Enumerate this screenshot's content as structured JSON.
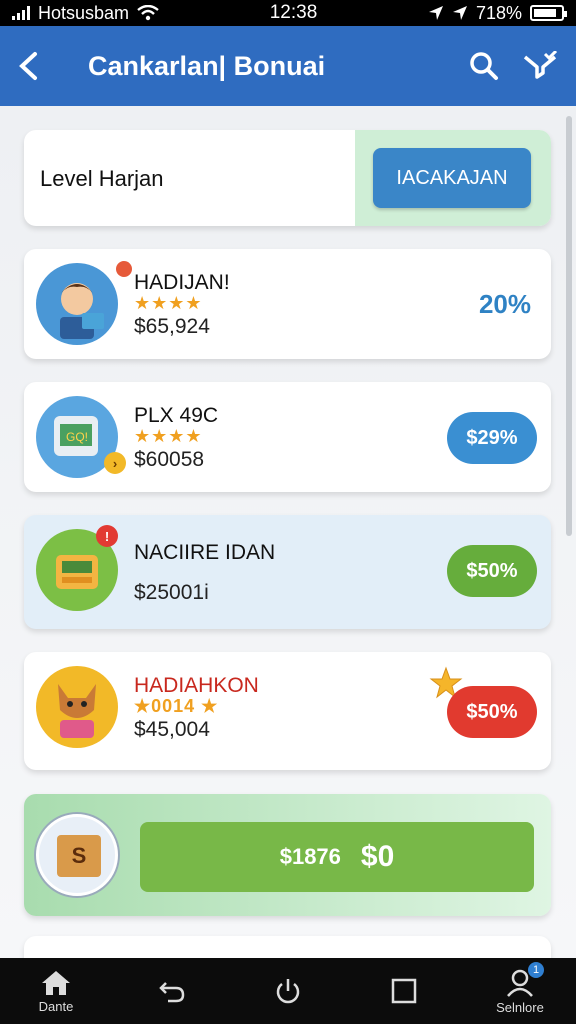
{
  "status_bar": {
    "carrier": "Hotsusbam",
    "time": "12:38",
    "battery": "718%"
  },
  "app_bar": {
    "title": "Cankarlan| Bonuai"
  },
  "level": {
    "label": "Level Harjan",
    "button": "IACAKAJAN"
  },
  "offers": [
    {
      "name": "HADIJAN!",
      "price": "$65,924",
      "discount": "20%",
      "stars": "★★★★"
    },
    {
      "name": "PLX 49C",
      "price": "$60058",
      "discount": "$29%",
      "stars": "★★★★"
    },
    {
      "name": "NACIIRE IDAN",
      "price": "$25001i",
      "discount": "$50%"
    },
    {
      "name": "HADIAHKON",
      "price": "$45,004",
      "discount": "$50%",
      "rating_text": "★0014 ★"
    }
  ],
  "bonus": {
    "amount": "$1876",
    "value": "$0"
  },
  "bottom_nav": {
    "home": "Dante",
    "profile": "Selnlore",
    "profile_badge": "1"
  },
  "colors": {
    "primary": "#2f6cc0",
    "green": "#66ad3c",
    "red": "#e13a2f",
    "blue_pill": "#3a8fd2"
  }
}
